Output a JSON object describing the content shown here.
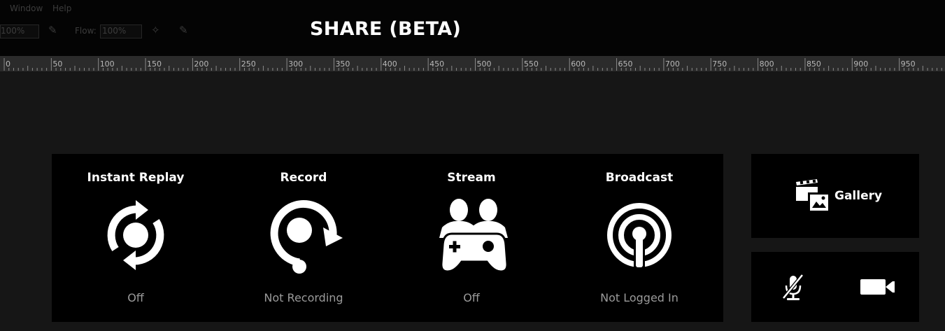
{
  "window": {
    "title": "SHARE (BETA)",
    "background_menu": [
      "Window",
      "Help"
    ],
    "background_toolbar": {
      "zoom": "100%",
      "flow_label": "Flow:",
      "flow_value": "100%"
    }
  },
  "ruler": {
    "labels": [
      "0",
      "50",
      "100",
      "150",
      "200",
      "250",
      "300",
      "350",
      "400",
      "450",
      "500",
      "550",
      "600",
      "650",
      "700",
      "750",
      "800",
      "850",
      "900",
      "950"
    ]
  },
  "features": [
    {
      "title": "Instant Replay",
      "status": "Off",
      "icon": "instant-replay-icon"
    },
    {
      "title": "Record",
      "status": "Not Recording",
      "icon": "record-icon"
    },
    {
      "title": "Stream",
      "status": "Off",
      "icon": "stream-icon"
    },
    {
      "title": "Broadcast",
      "status": "Not Logged In",
      "icon": "broadcast-icon"
    }
  ],
  "gallery": {
    "label": "Gallery",
    "icon": "gallery-icon"
  },
  "controls": {
    "microphone_icon": "microphone-muted-icon",
    "camera_icon": "camera-icon"
  },
  "colors": {
    "background": "#161616",
    "panel": "#000000",
    "status_text": "#9a9a9a",
    "ruler": "#2b2b2b"
  }
}
